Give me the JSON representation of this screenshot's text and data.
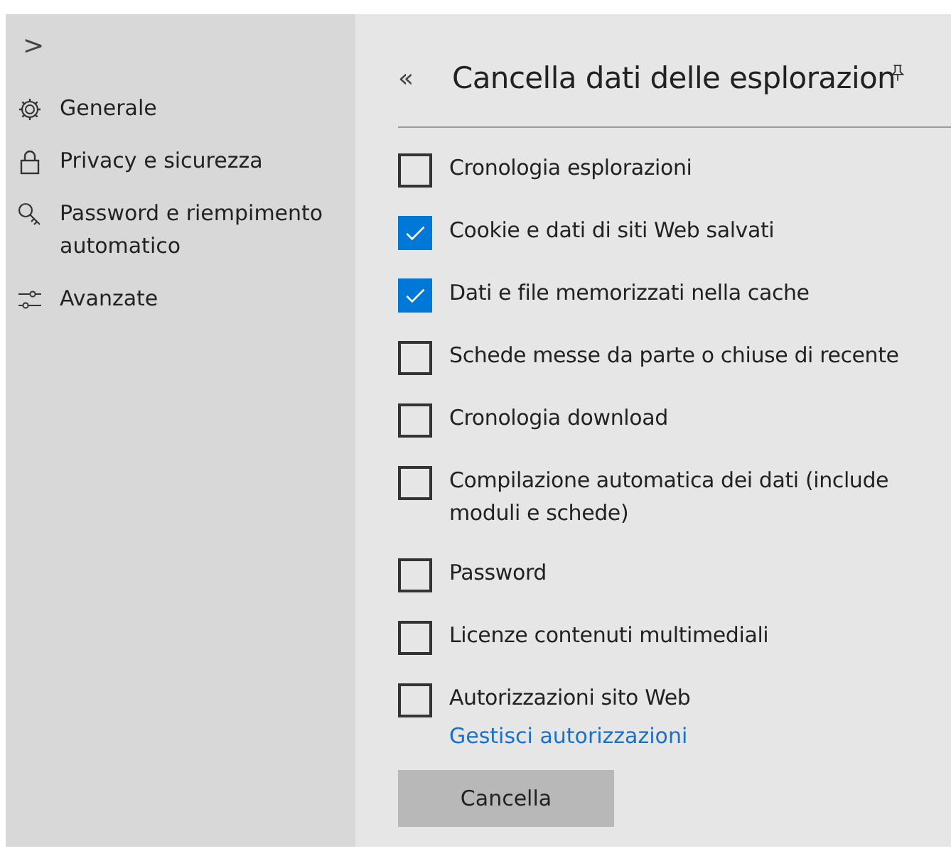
{
  "sidebar": {
    "expand_glyph": ">",
    "items": [
      {
        "kind": "gear",
        "label": "Generale"
      },
      {
        "kind": "lock",
        "label": "Privacy e sicurezza"
      },
      {
        "kind": "key",
        "label": "Password e riempimento automatico"
      },
      {
        "kind": "sliders",
        "label": "Avanzate"
      }
    ]
  },
  "panel": {
    "back_glyph": "«",
    "title": "Cancella dati delle esplorazion",
    "options": [
      {
        "label": "Cronologia esplorazioni",
        "checked": false
      },
      {
        "label": "Cookie e dati di siti Web salvati",
        "checked": true
      },
      {
        "label": "Dati e file memorizzati nella cache",
        "checked": true
      },
      {
        "label": "Schede messe da parte o chiuse di recente",
        "checked": false
      },
      {
        "label": "Cronologia download",
        "checked": false
      },
      {
        "label": "Compilazione automatica dei dati (include moduli e schede)",
        "checked": false
      },
      {
        "label": "Password",
        "checked": false
      },
      {
        "label": "Licenze contenuti multimediali",
        "checked": false
      },
      {
        "label": "Autorizzazioni sito Web",
        "checked": false
      }
    ],
    "link": "Gestisci autorizzazioni",
    "button": "Cancella"
  }
}
